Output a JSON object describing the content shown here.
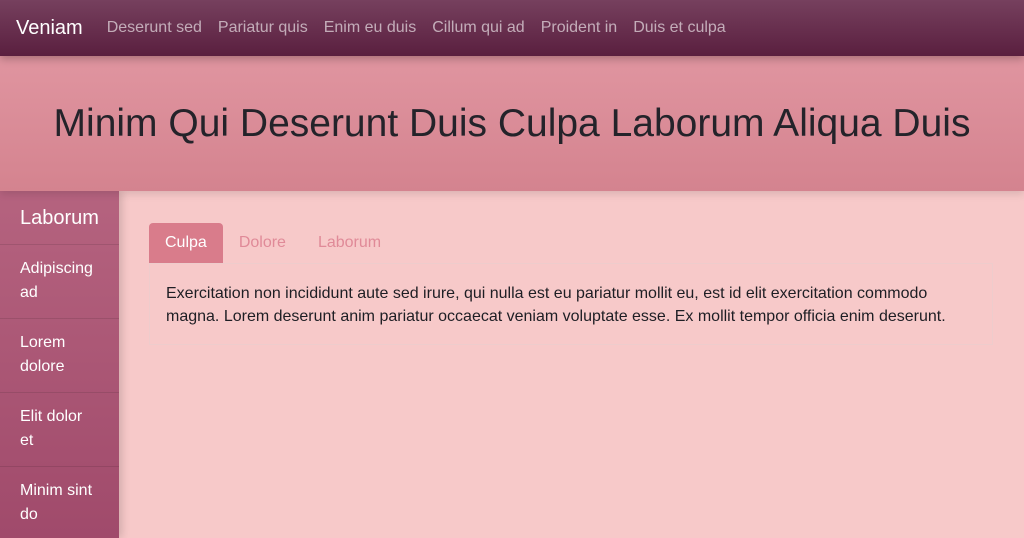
{
  "navbar": {
    "brand": "Veniam",
    "links": [
      "Deserunt sed",
      "Pariatur quis",
      "Enim eu duis",
      "Cillum qui ad",
      "Proident in",
      "Duis et culpa"
    ]
  },
  "hero": {
    "title": "Minim Qui Deserunt Duis Culpa Laborum Aliqua Duis"
  },
  "sidebar": {
    "heading": "Laborum",
    "items": [
      {
        "label": "Adipiscing ad"
      },
      {
        "label": "Lorem dolore"
      },
      {
        "label": "Elit dolor et"
      },
      {
        "label": "Minim sint do"
      }
    ]
  },
  "main": {
    "tabs": [
      {
        "label": "Culpa",
        "active": true
      },
      {
        "label": "Dolore",
        "active": false
      },
      {
        "label": "Laborum",
        "active": false
      }
    ],
    "panel_text": "Exercitation non incididunt aute sed irure, qui nulla est eu pariatur mollit eu, est id elit exercitation commodo magna. Lorem deserunt anim pariatur occaecat veniam voluptate esse. Ex mollit tempor officia enim deserunt."
  },
  "colors": {
    "navbar": "#5a1f3f",
    "hero": "#d98c98",
    "sidebar": "#a8527a",
    "background": "#f7c9c9",
    "tab_active": "#d97c8b",
    "tab_text": "#e08a98"
  }
}
